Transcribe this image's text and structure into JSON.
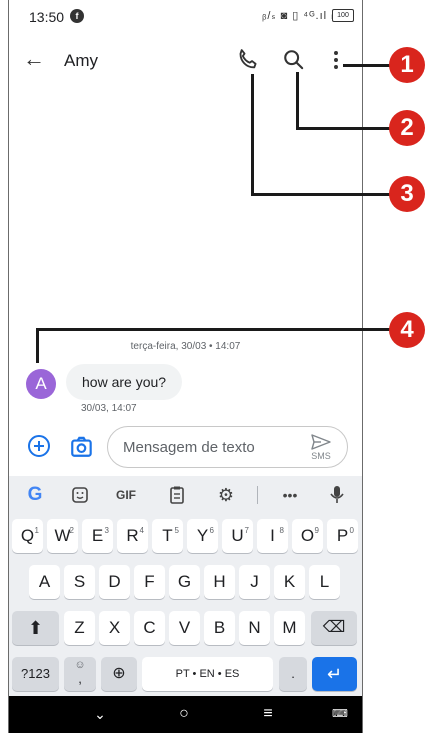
{
  "status_bar": {
    "time": "13:50",
    "notification_badge": "f",
    "system_icons": "ᵦ/ₛ ◙ ▯ ⁴ᴳ.ıl ₗ",
    "battery": "100"
  },
  "app_bar": {
    "title": "Amy",
    "back_icon": "arrow-left",
    "actions": [
      "phone",
      "search",
      "more-vert"
    ]
  },
  "conversation": {
    "date_separator": "terça-feira, 30/03 • 14:07",
    "messages": [
      {
        "avatar_letter": "A",
        "text": "how are you?",
        "timestamp": "30/03, 14:07",
        "avatar_color": "#9a66d8"
      }
    ]
  },
  "compose": {
    "placeholder": "Mensagem de texto",
    "send_label": "SMS"
  },
  "keyboard": {
    "toolbar": [
      "G",
      "sticker",
      "GIF",
      "clipboard",
      "settings",
      "•••",
      "mic"
    ],
    "row1": [
      {
        "k": "Q",
        "h": "1"
      },
      {
        "k": "W",
        "h": "2"
      },
      {
        "k": "E",
        "h": "3"
      },
      {
        "k": "R",
        "h": "4"
      },
      {
        "k": "T",
        "h": "5"
      },
      {
        "k": "Y",
        "h": "6"
      },
      {
        "k": "U",
        "h": "7"
      },
      {
        "k": "I",
        "h": "8"
      },
      {
        "k": "O",
        "h": "9"
      },
      {
        "k": "P",
        "h": "0"
      }
    ],
    "row2": [
      "A",
      "S",
      "D",
      "F",
      "G",
      "H",
      "J",
      "K",
      "L"
    ],
    "row3": [
      "Z",
      "X",
      "C",
      "V",
      "B",
      "N",
      "M"
    ],
    "bottom": {
      "symbols": "?123",
      "emoji_comma": ",",
      "space": "PT • EN • ES",
      "period": "."
    }
  },
  "nav_bar": [
    "back-chevron",
    "home-circle",
    "recents-lines",
    "keyboard"
  ],
  "callouts": [
    "1",
    "2",
    "3",
    "4"
  ],
  "colors": {
    "accent": "#1a73e8",
    "badge": "#d9251d",
    "avatar": "#9a66d8"
  }
}
